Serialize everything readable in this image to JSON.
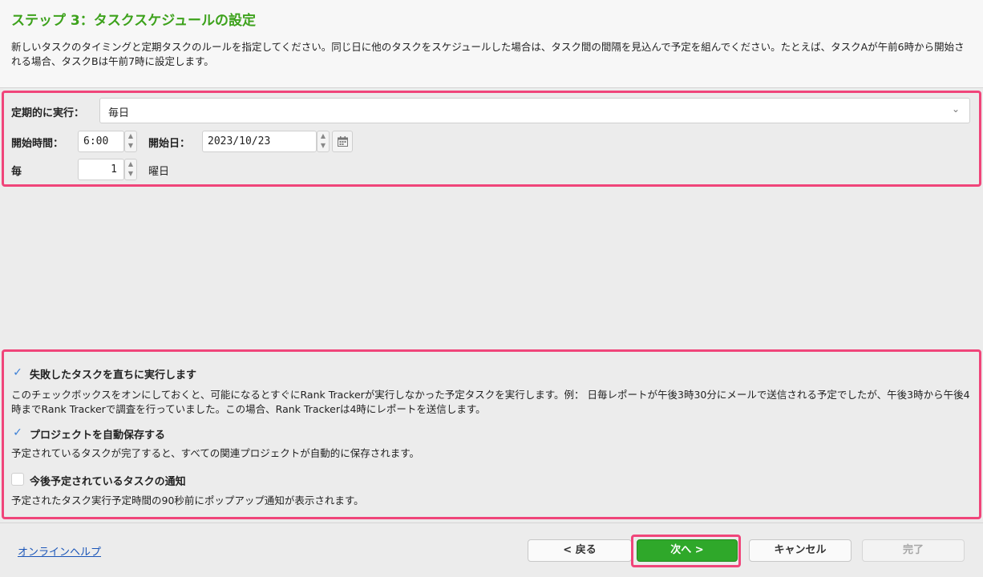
{
  "header": {
    "title": "ステップ 3：タスクスケジュールの設定",
    "description": "新しいタスクのタイミングと定期タスクのルールを指定してください。同じ日に他のタスクをスケジュールした場合は、タスク間の間隔を見込んで予定を組んでください。たとえば、タスクAが午前6時から開始される場合、タスクBは午前7時に設定します。"
  },
  "schedule": {
    "repeat_label": "定期的に実行：",
    "repeat_value": "毎日",
    "start_time_label": "開始時間：",
    "start_time_value": "6:00",
    "start_date_label": "開始日：",
    "start_date_value": "2023/10/23",
    "every_label": "毎",
    "every_value": "1",
    "every_unit": "曜日"
  },
  "options": [
    {
      "checked": true,
      "label": "失敗したタスクを直ちに実行します",
      "description": "このチェックボックスをオンにしておくと、可能になるとすぐにRank Trackerが実行しなかった予定タスクを実行します。例： 日毎レポートが午後3時30分にメールで送信される予定でしたが、午後3時から午後4時までRank Trackerで調査を行っていました。この場合、Rank Trackerは4時にレポートを送信します。"
    },
    {
      "checked": true,
      "label": "プロジェクトを自動保存する",
      "description": "予定されているタスクが完了すると、すべての関連プロジェクトが自動的に保存されます。"
    },
    {
      "checked": false,
      "label": "今後予定されているタスクの通知",
      "description": "予定されたタスク実行予定時間の90秒前にポップアップ通知が表示されます。"
    }
  ],
  "footer": {
    "help_link": "オンラインヘルプ",
    "back_label": "< 戻る",
    "next_label": "次へ >",
    "cancel_label": "キャンセル",
    "finish_label": "完了"
  },
  "colors": {
    "title_green": "#3da21c",
    "highlight_pink": "#f0457a",
    "primary_button": "#2fa82a",
    "link_blue": "#1a55b8"
  }
}
